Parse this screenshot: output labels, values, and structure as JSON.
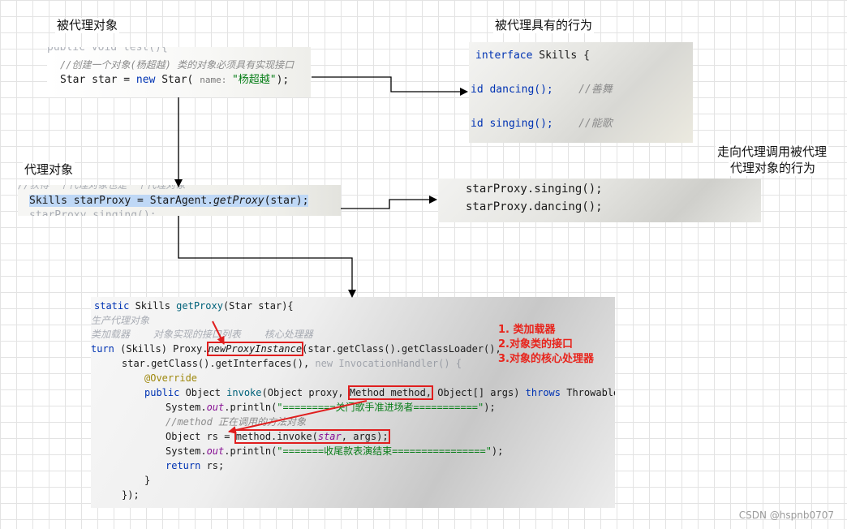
{
  "labels": {
    "proxied_object": "被代理对象",
    "proxied_behavior": "被代理具有的行为",
    "proxy_object": "代理对象",
    "proxy_call_line1": "走向代理调用被代理",
    "proxy_call_line2": "代理对象的行为"
  },
  "star_panel": {
    "line0": "public void test(){",
    "line1": "//创建一个对象(杨超越) 类的对象必须具有实现接口",
    "line2_pre": "Star star = ",
    "line2_kw": "new",
    "line2_mid": " Star( ",
    "line2_hint": "name: ",
    "line2_str": "\"杨超越\"",
    "line2_post": ");"
  },
  "skills_panel": {
    "line1_kw": "interface",
    "line1_rest": " Skills {",
    "line2_code": "id dancing();",
    "line2_comment": "//善舞",
    "line3_code": "id singing();",
    "line3_comment": "//能歌"
  },
  "proxy_panel": {
    "line0": "//获得一个代理对象也是一个代理对象",
    "line1_a": "Skills starProxy = StarAgent.",
    "line1_b": "getProxy",
    "line1_c": "(star);",
    "line2": "starProxy.singing();"
  },
  "calls_panel": {
    "line1": "starProxy.singing();",
    "line2": "starProxy.dancing();"
  },
  "getproxy_panel": {
    "l1_kw": "static",
    "l1_a": " Skills ",
    "l1_fn": "getProxy",
    "l1_b": "(Star star){",
    "l2": "生产代理对象",
    "l3": "类加载器    对象实现的接口列表    核心处理器",
    "l4_kw": "turn",
    "l4_a": " (Skills) Proxy.",
    "l4_box": "newProxyInstance",
    "l4_b": "(star.getClass().getClassLoader(),",
    "l5_a": "star.getClass().getInterfaces(), ",
    "l5_b": "new InvocationHandler() {",
    "l6": "@Override",
    "l7_kw": "public",
    "l7_a": " Object ",
    "l7_fn": "invoke",
    "l7_b": "(Object proxy, ",
    "l7_box": "Method method,",
    "l7_c": " Object[] args) ",
    "l7_kw2": "throws",
    "l7_d": " Throwable {",
    "l8_a": "System.",
    "l8_fi": "out",
    "l8_b": ".println(",
    "l8_str": "\"=========关门歌手准进场者===========\"",
    "l8_c": ");",
    "l9": "//method 正在调用的方法对象",
    "l10_a": "Object rs = ",
    "l10_box_a": "method.invoke(",
    "l10_box_b": "star",
    "l10_box_c": ", args);",
    "l11_a": "System.",
    "l11_fi": "out",
    "l11_b": ".println(",
    "l11_str": "\"=======收尾款表演结束================\"",
    "l11_c": ");",
    "l12_kw": "return",
    "l12_a": " rs;",
    "l13": "}",
    "l14": "});"
  },
  "annotations": {
    "a1": "1. 类加载器",
    "a2": "2.对象类的接口",
    "a3": "3.对象的核心处理器"
  },
  "watermark": "CSDN @hspnb0707",
  "colors": {
    "annotation_red": "#e8241c",
    "keyword_blue": "#0033b3",
    "selection_blue": "#bfd8f6"
  }
}
